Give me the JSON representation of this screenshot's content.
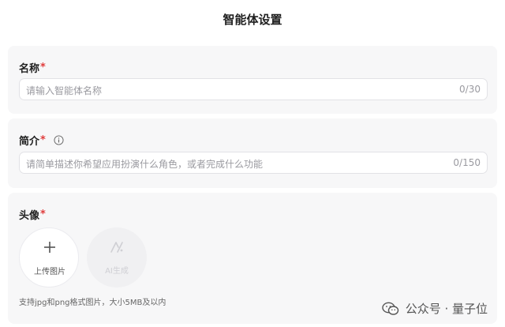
{
  "header": {
    "title": "智能体设置"
  },
  "name_section": {
    "label": "名称",
    "required_mark": "*",
    "placeholder": "请输入智能体名称",
    "counter": "0/30"
  },
  "intro_section": {
    "label": "简介",
    "required_mark": "*",
    "placeholder": "请简单描述你希望应用扮演什么角色，或者完成什么功能",
    "counter": "0/150",
    "info_icon": "info-circle-icon"
  },
  "avatar_section": {
    "label": "头像",
    "required_mark": "*",
    "upload_label": "上传图片",
    "ai_generate_label": "AI生成",
    "hint": "支持jpg和png格式图片，大小5MB及以内"
  },
  "watermark": {
    "text": "公众号 · 量子位",
    "icon": "wechat-icon"
  },
  "colors": {
    "required": "#e03c3c",
    "card_bg": "#f7f7f8",
    "placeholder": "#9a9aa0"
  }
}
